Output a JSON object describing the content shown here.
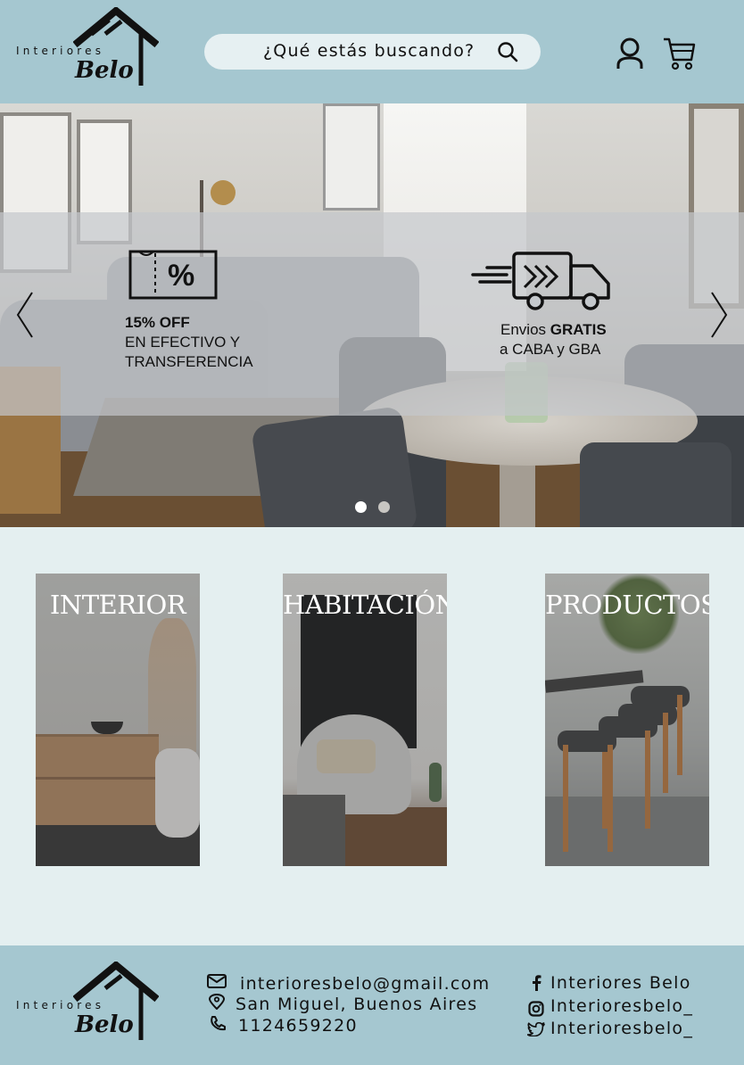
{
  "header": {
    "logo_word": "Interiores",
    "logo_brand": "Belo",
    "search": {
      "placeholder": "¿Qué estás buscando?"
    },
    "icons": [
      "search-icon",
      "user-icon",
      "cart-icon"
    ]
  },
  "hero": {
    "promos": [
      {
        "line1": "15% OFF",
        "line2": "EN EFECTIVO Y",
        "line3": "TRANSFERENCIA",
        "icon": "discount-ticket-icon"
      },
      {
        "line1_prefix": "Envios ",
        "line1_bold": "GRATIS",
        "line2": "a CABA y GBA",
        "icon": "delivery-truck-icon"
      }
    ],
    "slides_total": 2,
    "active_slide": 1
  },
  "categories": [
    {
      "label": "INTERIOR"
    },
    {
      "label": "HABITACIÓN"
    },
    {
      "label": "PRODUCTOS"
    }
  ],
  "footer": {
    "logo_word": "Interiores",
    "logo_brand": "Belo",
    "email": "interioresbelo@gmail.com",
    "location": "San Miguel, Buenos Aires",
    "phone": "1124659220",
    "facebook": "Interiores Belo",
    "instagram": "Interioresbelo_",
    "twitter": "Interioresbelo_"
  },
  "colors": {
    "header_bg": "#a5c7d0",
    "page_bg": "#e4eff0",
    "search_bg": "#e6f0f2"
  }
}
